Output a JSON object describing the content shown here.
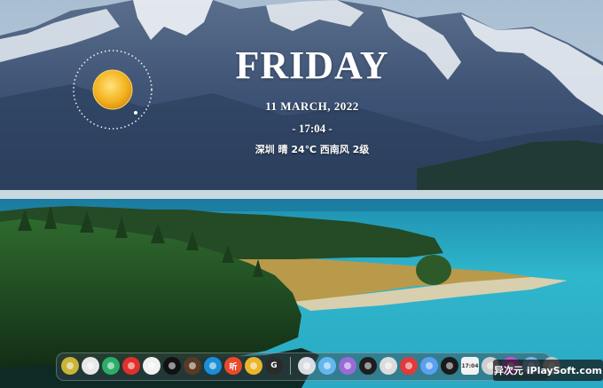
{
  "widget": {
    "day": "FRIDAY",
    "date": "11  MARCH, 2022",
    "time": "- 17:04 -",
    "weather": "深圳 晴 24℃ 西南风 2级"
  },
  "weather_icon": "sun-icon",
  "dock": {
    "left_apps": [
      {
        "name": "dock-app-1",
        "icon": "leaf-icon",
        "color": "#c8b436",
        "glyph": ""
      },
      {
        "name": "dock-app-2",
        "icon": "qq-penguin-icon",
        "color": "#e8e8e8",
        "glyph": ""
      },
      {
        "name": "dock-app-3",
        "icon": "wechat-icon",
        "color": "#2aae67",
        "glyph": ""
      },
      {
        "name": "dock-app-4",
        "icon": "netease-music-icon",
        "color": "#e0312b",
        "glyph": ""
      },
      {
        "name": "dock-app-5",
        "icon": "qq-icon",
        "color": "#f1f1f1",
        "glyph": ""
      },
      {
        "name": "dock-app-6",
        "icon": "capcut-icon",
        "color": "#111111",
        "glyph": ""
      },
      {
        "name": "dock-app-7",
        "icon": "coffee-icon",
        "color": "#5a3a22",
        "glyph": ""
      },
      {
        "name": "dock-app-8",
        "icon": "edge-icon",
        "color": "#1a8fd8",
        "glyph": ""
      },
      {
        "name": "dock-app-9",
        "icon": "ting-icon",
        "color": "#e94a2a",
        "glyph": "听"
      },
      {
        "name": "dock-app-10",
        "icon": "chrome-icon",
        "color": "#e8b52b",
        "glyph": ""
      },
      {
        "name": "dock-app-11",
        "icon": "g-icon",
        "color": "#2b2b2b",
        "glyph": "G"
      }
    ],
    "right_apps": [
      {
        "name": "dock-app-12",
        "icon": "rocket-icon",
        "color": "#d9dde3",
        "glyph": ""
      },
      {
        "name": "dock-app-13",
        "icon": "cloud-icon",
        "color": "#64b6ee",
        "glyph": ""
      },
      {
        "name": "dock-app-14",
        "icon": "color-ring-icon",
        "color": "#9a6ad8",
        "glyph": ""
      },
      {
        "name": "dock-app-15",
        "icon": "dots-icon",
        "color": "#1e1e1e",
        "glyph": ""
      },
      {
        "name": "dock-app-16",
        "icon": "aperture-icon",
        "color": "#dcdcdc",
        "glyph": ""
      },
      {
        "name": "dock-app-17",
        "icon": "refresh-icon",
        "color": "#e23a3a",
        "glyph": ""
      },
      {
        "name": "dock-app-18",
        "icon": "cloud-drive-icon",
        "color": "#5b9ff0",
        "glyph": ""
      },
      {
        "name": "dock-app-19",
        "icon": "screen-time-icon",
        "color": "#1a1a1a",
        "glyph": ""
      },
      {
        "name": "dock-app-20",
        "icon": "clock-icon",
        "color": "#f2f2f2",
        "glyph": ""
      },
      {
        "name": "dock-app-21",
        "icon": "widget-icon",
        "color": "#cfcfcf",
        "glyph": ""
      },
      {
        "name": "dock-app-22",
        "icon": "gradient-icon",
        "color": "#d24bd6",
        "glyph": ""
      },
      {
        "name": "dock-app-23",
        "icon": "photos-icon",
        "color": "#7fb4e8",
        "glyph": ""
      },
      {
        "name": "dock-app-24",
        "icon": "trash-icon",
        "color": "#bfc5cc",
        "glyph": ""
      }
    ],
    "clock_label": "17:04"
  },
  "watermark": "异次元 iPlaySoft.com",
  "colors": {
    "lake": "#2fb0c8",
    "sky": "#bcd0e0",
    "mountain": "#3a4f70",
    "forest": "#1f4a22"
  }
}
